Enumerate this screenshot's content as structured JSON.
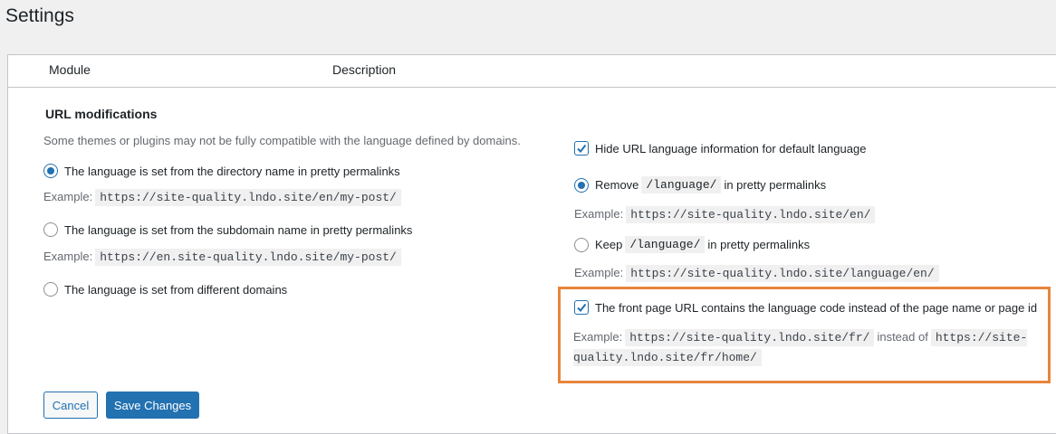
{
  "page": {
    "title": "Settings"
  },
  "table": {
    "col_module": "Module",
    "col_description": "Description"
  },
  "section": {
    "title": "URL modifications",
    "description": "Some themes or plugins may not be fully compatible with the language defined by domains."
  },
  "left_options": [
    {
      "label": "The language is set from the directory name in pretty permalinks",
      "checked": true,
      "example_prefix": "Example:",
      "example_code": "https://site-quality.lndo.site/en/my-post/"
    },
    {
      "label": "The language is set from the subdomain name in pretty permalinks",
      "checked": false,
      "example_prefix": "Example:",
      "example_code": "https://en.site-quality.lndo.site/my-post/"
    },
    {
      "label": "The language is set from different domains",
      "checked": false
    }
  ],
  "right": {
    "hide_default": {
      "label": "Hide URL language information for default language",
      "checked": true
    },
    "remove": {
      "before": "Remove",
      "code": "/language/",
      "after": "in pretty permalinks",
      "checked": true,
      "example_prefix": "Example:",
      "example_code": "https://site-quality.lndo.site/en/"
    },
    "keep": {
      "before": "Keep",
      "code": "/language/",
      "after": "in pretty permalinks",
      "checked": false,
      "example_prefix": "Example:",
      "example_code": "https://site-quality.lndo.site/language/en/"
    },
    "front_page": {
      "label": "The front page URL contains the language code instead of the page name or page id",
      "checked": true,
      "example_prefix": "Example:",
      "example_code1": "https://site-quality.lndo.site/fr/",
      "instead_of": "instead of",
      "example_code2": "https://site-quality.lndo.site/fr/home/"
    }
  },
  "buttons": {
    "cancel": "Cancel",
    "save": "Save Changes"
  },
  "colors": {
    "accent": "#2271b1",
    "highlight": "#e8843c"
  }
}
